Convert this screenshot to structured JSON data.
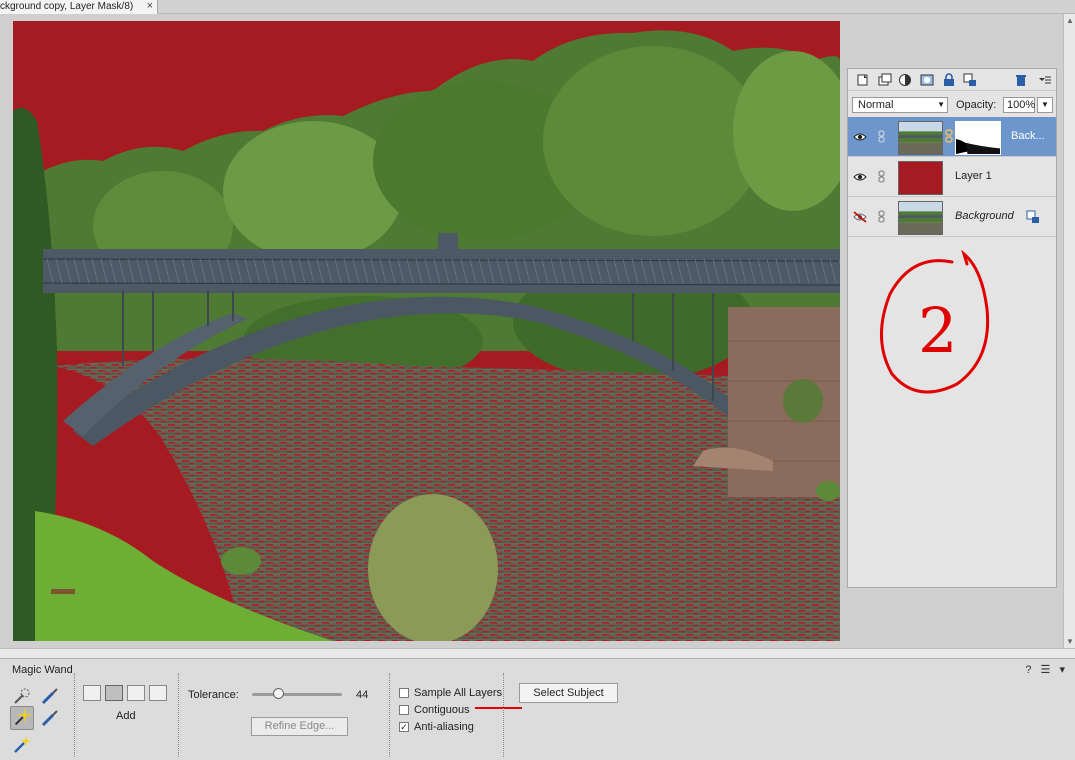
{
  "document": {
    "tab_title": "ckground copy, Layer Mask/8)",
    "close_glyph": "×"
  },
  "layers_panel": {
    "toolbar_icons": [
      "new-layer-icon",
      "new-group-icon",
      "adjustment-layer-icon",
      "add-mask-icon",
      "lock-all-icon",
      "lock-transparent-icon",
      "delete-layer-icon",
      "panel-menu-icon"
    ],
    "blend_mode": "Normal",
    "opacity_label": "Opacity:",
    "opacity_value": "100%",
    "layers": [
      {
        "name": "Back...",
        "visible": true,
        "selected": true,
        "has_mask": true,
        "italic": false
      },
      {
        "name": "Layer 1",
        "visible": true,
        "selected": false,
        "has_mask": false,
        "italic": false,
        "fill_color": "#a61b21"
      },
      {
        "name": "Background",
        "visible": false,
        "selected": false,
        "has_mask": false,
        "italic": true,
        "locked": true
      }
    ]
  },
  "annotation": {
    "text": "2",
    "color": "#e00000"
  },
  "tool_options": {
    "tool_name": "Magic Wand",
    "help_glyph": "?",
    "selection_mode_label": "Add",
    "tolerance_label": "Tolerance:",
    "tolerance_value": "44",
    "tolerance_fraction": 0.44,
    "refine_edge_label": "Refine Edge...",
    "checkboxes": [
      {
        "label": "Sample All Layers",
        "checked": false
      },
      {
        "label": "Contiguous",
        "checked": false
      },
      {
        "label": "Anti-aliasing",
        "checked": true
      }
    ],
    "select_subject_label": "Select Subject"
  },
  "colors": {
    "mask_overlay": "#a61b21",
    "selected_row": "#6d97cc",
    "annotation": "#e00000"
  }
}
